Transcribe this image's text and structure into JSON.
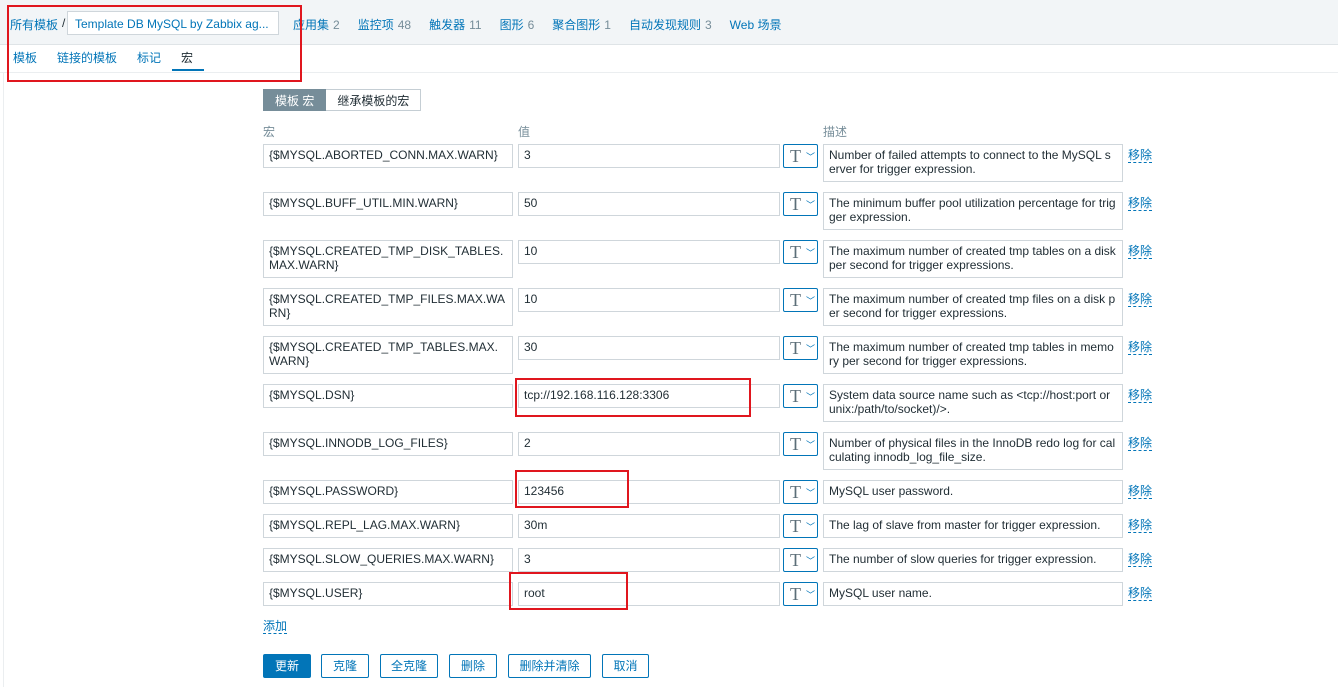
{
  "breadcrumb": {
    "all_templates": "所有模板",
    "separator": "/",
    "current_template": "Template DB MySQL by Zabbix ag..."
  },
  "top_tabs": [
    {
      "label": "应用集",
      "count": "2"
    },
    {
      "label": "监控项",
      "count": "48"
    },
    {
      "label": "触发器",
      "count": "11"
    },
    {
      "label": "图形",
      "count": "6"
    },
    {
      "label": "聚合图形",
      "count": "1"
    },
    {
      "label": "自动发现规则",
      "count": "3"
    },
    {
      "label": "Web 场景",
      "count": ""
    }
  ],
  "sub_tabs": [
    "模板",
    "链接的模板",
    "标记",
    "宏"
  ],
  "active_sub_tab": "宏",
  "toggle": {
    "template_macros": "模板 宏",
    "inherited_macros": "继承模板的宏"
  },
  "columns": {
    "macro": "宏",
    "value": "值",
    "description": "描述"
  },
  "macros": [
    {
      "macro": "{$MYSQL.ABORTED_CONN.MAX.WARN}",
      "value": "3",
      "description": "Number of failed attempts to connect to the MySQL server for trigger expression.",
      "type": "T",
      "remove": "移除"
    },
    {
      "macro": "{$MYSQL.BUFF_UTIL.MIN.WARN}",
      "value": "50",
      "description": "The minimum buffer pool utilization percentage for trigger expression.",
      "type": "T",
      "remove": "移除"
    },
    {
      "macro": "{$MYSQL.CREATED_TMP_DISK_TABLES.MAX.WARN}",
      "value": "10",
      "description": "The maximum number of created tmp tables on a disk per second for trigger expressions.",
      "type": "T",
      "remove": "移除"
    },
    {
      "macro": "{$MYSQL.CREATED_TMP_FILES.MAX.WARN}",
      "value": "10",
      "description": "The maximum number of created tmp files on a disk per second for trigger expressions.",
      "type": "T",
      "remove": "移除"
    },
    {
      "macro": "{$MYSQL.CREATED_TMP_TABLES.MAX.WARN}",
      "value": "30",
      "description": "The maximum number of created tmp tables in memory per second for trigger expressions.",
      "type": "T",
      "remove": "移除"
    },
    {
      "macro": "{$MYSQL.DSN}",
      "value": "tcp://192.168.116.128:3306",
      "description": "System data source name such as <tcp://host:port or unix:/path/to/socket)/>.",
      "type": "T",
      "remove": "移除"
    },
    {
      "macro": "{$MYSQL.INNODB_LOG_FILES}",
      "value": "2",
      "description": "Number of physical files in the InnoDB redo log for calculating innodb_log_file_size.",
      "type": "T",
      "remove": "移除"
    },
    {
      "macro": "{$MYSQL.PASSWORD}",
      "value": "123456",
      "description": "MySQL user password.",
      "type": "T",
      "remove": "移除"
    },
    {
      "macro": "{$MYSQL.REPL_LAG.MAX.WARN}",
      "value": "30m",
      "description": "The lag of slave from master for trigger expression.",
      "type": "T",
      "remove": "移除"
    },
    {
      "macro": "{$MYSQL.SLOW_QUERIES.MAX.WARN}",
      "value": "3",
      "description": "The number of slow queries for trigger expression.",
      "type": "T",
      "remove": "移除"
    },
    {
      "macro": "{$MYSQL.USER}",
      "value": "root",
      "description": "MySQL user name.",
      "type": "T",
      "remove": "移除"
    }
  ],
  "add_link": "添加",
  "buttons": {
    "update": "更新",
    "clone": "克隆",
    "full_clone": "全克隆",
    "delete": "删除",
    "delete_clear": "删除并清除",
    "cancel": "取消"
  },
  "colors": {
    "link": "#0275b8",
    "highlight": "#e0161e",
    "toggle_active": "#768d99"
  }
}
